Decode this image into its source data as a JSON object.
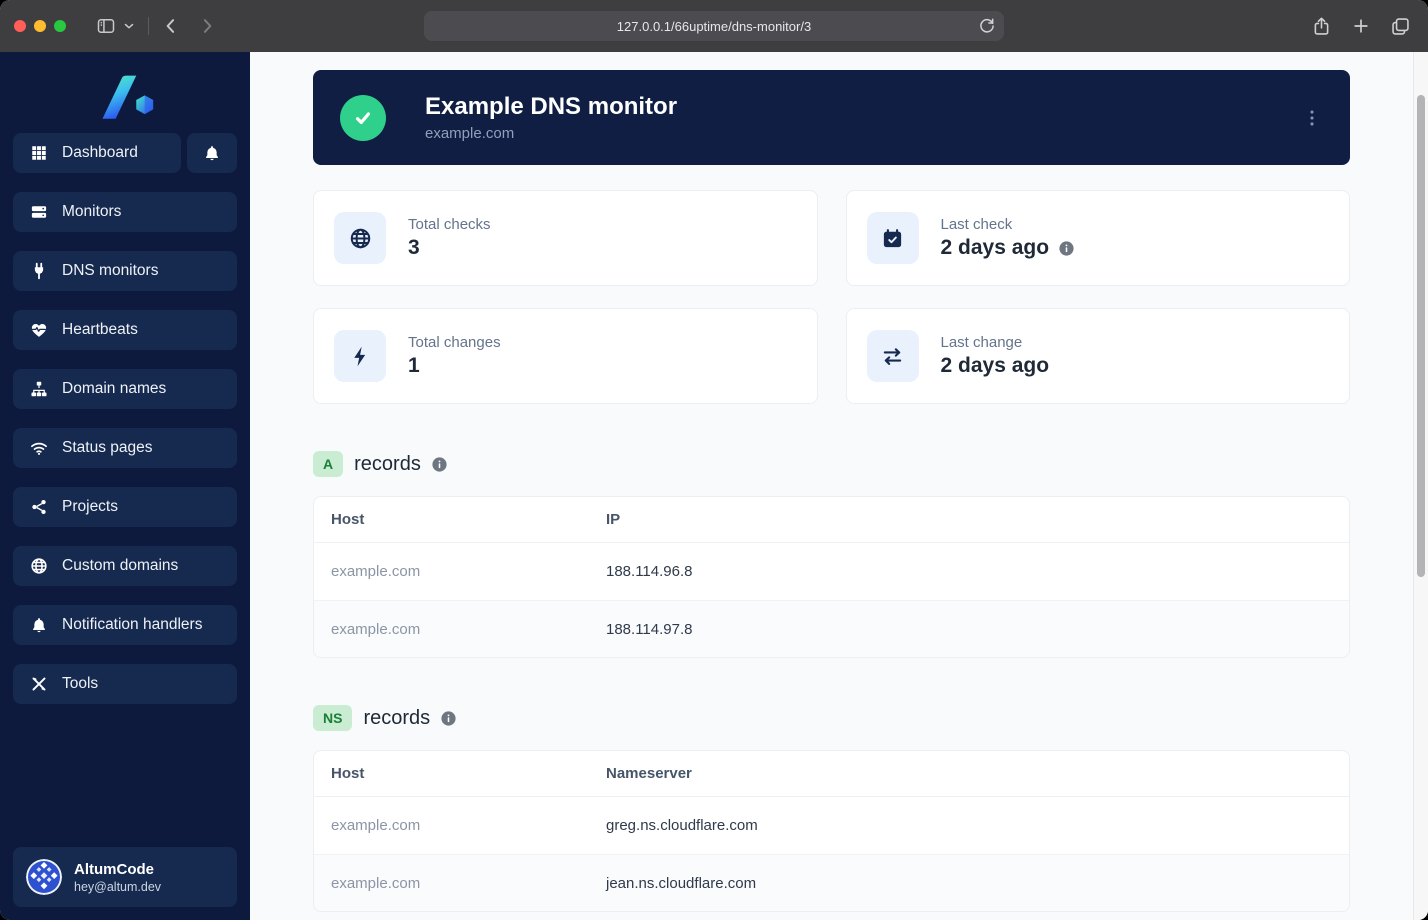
{
  "browser": {
    "url": "127.0.0.1/66uptime/dns-monitor/3"
  },
  "sidebar": {
    "dashboard": {
      "label": "Dashboard",
      "icon": "grid-icon"
    },
    "bell_icon": "bell-icon",
    "items": [
      {
        "label": "Monitors",
        "icon": "server-icon"
      },
      {
        "label": "DNS monitors",
        "icon": "plug-icon"
      },
      {
        "label": "Heartbeats",
        "icon": "heart-pulse-icon"
      },
      {
        "label": "Domain names",
        "icon": "sitemap-icon"
      },
      {
        "label": "Status pages",
        "icon": "wifi-icon"
      },
      {
        "label": "Projects",
        "icon": "share-nodes-icon"
      },
      {
        "label": "Custom domains",
        "icon": "globe-icon"
      },
      {
        "label": "Notification handlers",
        "icon": "bell-icon"
      },
      {
        "label": "Tools",
        "icon": "tools-icon"
      }
    ],
    "user": {
      "name": "AltumCode",
      "email": "hey@altum.dev"
    }
  },
  "header": {
    "title": "Example DNS monitor",
    "subtitle": "example.com",
    "status": "up",
    "status_icon": "check-icon",
    "menu_icon": "ellipsis-vertical-icon"
  },
  "stats": [
    {
      "icon": "globe-icon",
      "label": "Total checks",
      "value": "3",
      "info": false
    },
    {
      "icon": "calendar-check-icon",
      "label": "Last check",
      "value": "2 days ago",
      "info": true
    },
    {
      "icon": "bolt-icon",
      "label": "Total changes",
      "value": "1",
      "info": false
    },
    {
      "icon": "arrows-swap-icon",
      "label": "Last change",
      "value": "2 days ago",
      "info": false
    }
  ],
  "sections": [
    {
      "badge": "A",
      "title": "records",
      "info": true,
      "columns": [
        "Host",
        "IP"
      ],
      "rows": [
        [
          "example.com",
          "188.114.96.8"
        ],
        [
          "example.com",
          "188.114.97.8"
        ]
      ]
    },
    {
      "badge": "NS",
      "title": "records",
      "info": true,
      "columns": [
        "Host",
        "Nameserver"
      ],
      "rows": [
        [
          "example.com",
          "greg.ns.cloudflare.com"
        ],
        [
          "example.com",
          "jean.ns.cloudflare.com"
        ]
      ]
    }
  ],
  "colors": {
    "titlebar": "#3e3e41",
    "urlbar": "#4c4c50",
    "traffic_red": "#ff5f57",
    "traffic_yellow": "#febc2e",
    "traffic_green": "#28c840",
    "sidebar_bg": "#0d1a3e",
    "sidebar_item_bg": "#16294f",
    "header_card_bg": "#0f1e42",
    "success_green": "#2fd08c",
    "page_bg": "#f8fafc",
    "card_border": "#ebeef3",
    "stat_icon_bg": "#e9f1fd",
    "stat_icon_fg": "#16294f",
    "label_gray": "#64748b",
    "value_dark": "#1f2937",
    "badge_green_bg": "#c9ecd2",
    "badge_green_text": "#1a7f37",
    "info_gray": "#6e7681",
    "host_gray": "#8b95a5",
    "cell_dark": "#2f3a4a",
    "scroll_thumb": "#b4b4b6"
  }
}
